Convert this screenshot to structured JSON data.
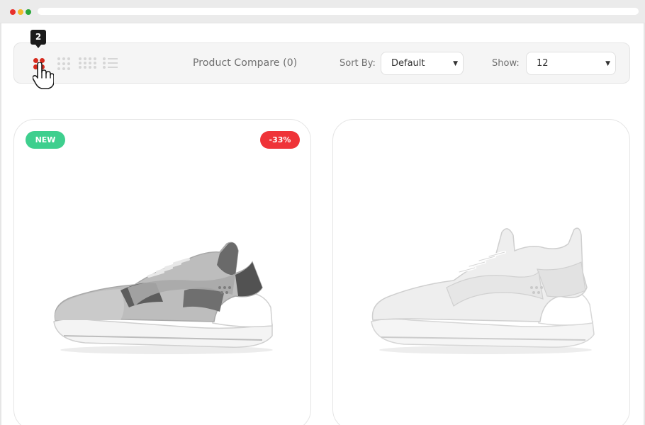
{
  "toolbar": {
    "tooltip_value": "2",
    "compare_label": "Product Compare (0)",
    "sort_label": "Sort By:",
    "sort_value": "Default",
    "show_label": "Show:",
    "show_value": "12",
    "active_view_color": "#d62b1f"
  },
  "products": [
    {
      "badges": {
        "new": "NEW",
        "sale": "-33%"
      }
    },
    {
      "badges": {}
    }
  ],
  "colors": {
    "new_badge": "#3ecf8e",
    "sale_badge": "#ef3338"
  }
}
